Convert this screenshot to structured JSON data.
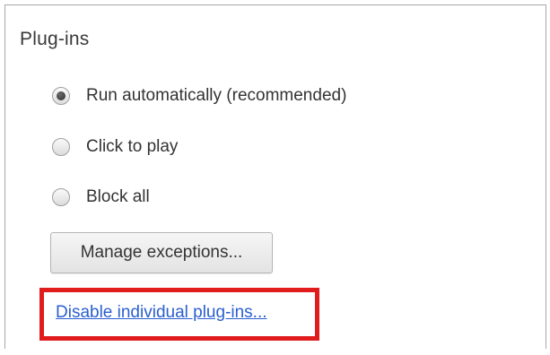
{
  "section": {
    "title": "Plug-ins"
  },
  "options": [
    {
      "label": "Run automatically (recommended)",
      "checked": true
    },
    {
      "label": "Click to play",
      "checked": false
    },
    {
      "label": "Block all",
      "checked": false
    }
  ],
  "buttons": {
    "manage_exceptions": "Manage exceptions..."
  },
  "links": {
    "disable_individual": "Disable individual plug-ins..."
  },
  "colors": {
    "highlight": "#e01c1c",
    "link": "#2a5fcf"
  }
}
